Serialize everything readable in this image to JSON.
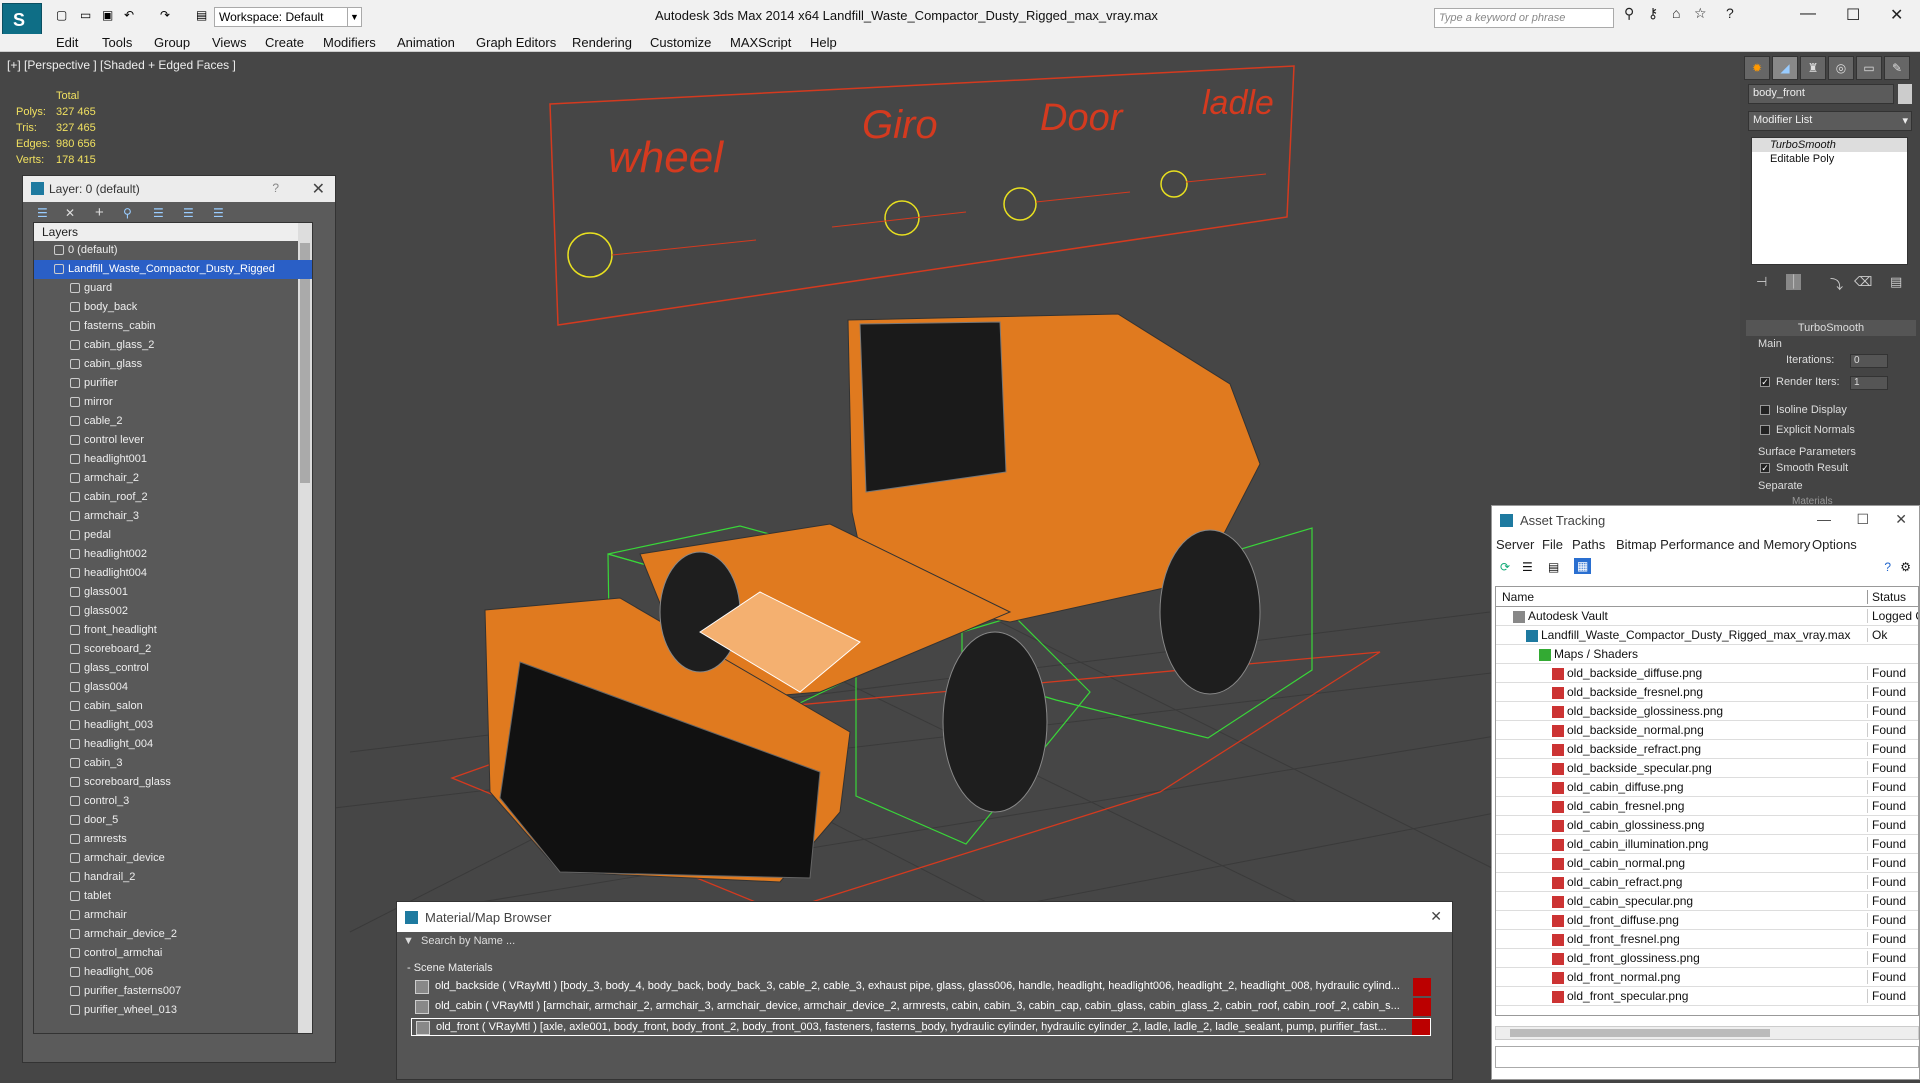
{
  "app": {
    "title": "Autodesk 3ds Max  2014 x64      Landfill_Waste_Compactor_Dusty_Rigged_max_vray.max",
    "workspace": "Workspace: Default",
    "search_placeholder": "Type a keyword or phrase"
  },
  "menu": [
    "Edit",
    "Tools",
    "Group",
    "Views",
    "Create",
    "Modifiers",
    "Animation",
    "Graph Editors",
    "Rendering",
    "Customize",
    "MAXScript",
    "Help"
  ],
  "viewport": {
    "label": "[+] [Perspective ] [Shaded + Edged Faces ]",
    "stats_header": "Total",
    "stats": [
      {
        "label": "Polys:",
        "value": "327 465"
      },
      {
        "label": "Tris:",
        "value": "327 465"
      },
      {
        "label": "Edges:",
        "value": "980 656"
      },
      {
        "label": "Verts:",
        "value": "178 415"
      }
    ],
    "rig_labels": [
      "wheel",
      "Giro",
      "Door",
      "ladle"
    ]
  },
  "layers": {
    "title": "Layer: 0 (default)",
    "help": "?",
    "header": "Layers",
    "items": [
      "0 (default)",
      "Landfill_Waste_Compactor_Dusty_Rigged",
      "guard",
      "body_back",
      "fasterns_cabin",
      "cabin_glass_2",
      "cabin_glass",
      "purifier",
      "mirror",
      "cable_2",
      "control lever",
      "headlight001",
      "armchair_2",
      "cabin_roof_2",
      "armchair_3",
      "pedal",
      "headlight002",
      "headlight004",
      "glass001",
      "glass002",
      "front_headlight",
      "scoreboard_2",
      "glass_control",
      "glass004",
      "cabin_salon",
      "headlight_003",
      "headlight_004",
      "cabin_3",
      "scoreboard_glass",
      "control_3",
      "door_5",
      "armrests",
      "armchair_device",
      "handrail_2",
      "tablet",
      "armchair",
      "armchair_device_2",
      "control_armchai",
      "headlight_006",
      "purifier_fasterns007",
      "purifier_wheel_013"
    ]
  },
  "command_panel": {
    "object_name": "body_front",
    "modifier_list": "Modifier List",
    "stack": [
      "TurboSmooth",
      "Editable Poly"
    ],
    "rollout_title": "TurboSmooth",
    "main": "Main",
    "iterations_label": "Iterations:",
    "iterations_value": "0",
    "render_iters_label": "Render Iters:",
    "render_iters_value": "1",
    "isoline": "Isoline Display",
    "explicit_normals": "Explicit Normals",
    "surface_params": "Surface Parameters",
    "smooth_result": "Smooth Result",
    "separate": "Separate",
    "materials": "Materials"
  },
  "asset_tracking": {
    "title": "Asset Tracking",
    "menu": [
      "Server",
      "File",
      "Paths",
      "Bitmap Performance and Memory",
      "Options"
    ],
    "col_name": "Name",
    "col_status": "Status",
    "rows": [
      {
        "name": "Autodesk Vault",
        "status": "Logged O",
        "indent": 1
      },
      {
        "name": "Landfill_Waste_Compactor_Dusty_Rigged_max_vray.max",
        "status": "Ok",
        "indent": 2
      },
      {
        "name": "Maps / Shaders",
        "status": "",
        "indent": 3
      },
      {
        "name": "old_backside_diffuse.png",
        "status": "Found",
        "indent": 4
      },
      {
        "name": "old_backside_fresnel.png",
        "status": "Found",
        "indent": 4
      },
      {
        "name": "old_backside_glossiness.png",
        "status": "Found",
        "indent": 4
      },
      {
        "name": "old_backside_normal.png",
        "status": "Found",
        "indent": 4
      },
      {
        "name": "old_backside_refract.png",
        "status": "Found",
        "indent": 4
      },
      {
        "name": "old_backside_specular.png",
        "status": "Found",
        "indent": 4
      },
      {
        "name": "old_cabin_diffuse.png",
        "status": "Found",
        "indent": 4
      },
      {
        "name": "old_cabin_fresnel.png",
        "status": "Found",
        "indent": 4
      },
      {
        "name": "old_cabin_glossiness.png",
        "status": "Found",
        "indent": 4
      },
      {
        "name": "old_cabin_illumination.png",
        "status": "Found",
        "indent": 4
      },
      {
        "name": "old_cabin_normal.png",
        "status": "Found",
        "indent": 4
      },
      {
        "name": "old_cabin_refract.png",
        "status": "Found",
        "indent": 4
      },
      {
        "name": "old_cabin_specular.png",
        "status": "Found",
        "indent": 4
      },
      {
        "name": "old_front_diffuse.png",
        "status": "Found",
        "indent": 4
      },
      {
        "name": "old_front_fresnel.png",
        "status": "Found",
        "indent": 4
      },
      {
        "name": "old_front_glossiness.png",
        "status": "Found",
        "indent": 4
      },
      {
        "name": "old_front_normal.png",
        "status": "Found",
        "indent": 4
      },
      {
        "name": "old_front_specular.png",
        "status": "Found",
        "indent": 4
      }
    ]
  },
  "material_browser": {
    "title": "Material/Map Browser",
    "search": "Search by Name ...",
    "section": "- Scene Materials",
    "rows": [
      "old_backside  ( VRayMtl ) [body_3, body_4, body_back, body_back_3, cable_2, cable_3, exhaust pipe, glass, glass006, handle, headlight, headlight006, headlight_2, headlight_008, hydraulic cylind...",
      "old_cabin  ( VRayMtl ) [armchair, armchair_2, armchair_3, armchair_device, armchair_device_2, armrests, cabin, cabin_3, cabin_cap, cabin_glass, cabin_glass_2, cabin_roof, cabin_roof_2, cabin_s...",
      "old_front  ( VRayMtl ) [axle, axle001, body_front, body_front_2, body_front_003, fasteners, fasterns_body, hydraulic cylinder, hydraulic cylinder_2, ladle, ladle_2, ladle_sealant, pump, purifier_fast..."
    ]
  },
  "colors": {
    "accent": "#2a5fc6",
    "machine": "#e07a1f",
    "rig": "#d43a1f",
    "bbox": "#39d639"
  }
}
